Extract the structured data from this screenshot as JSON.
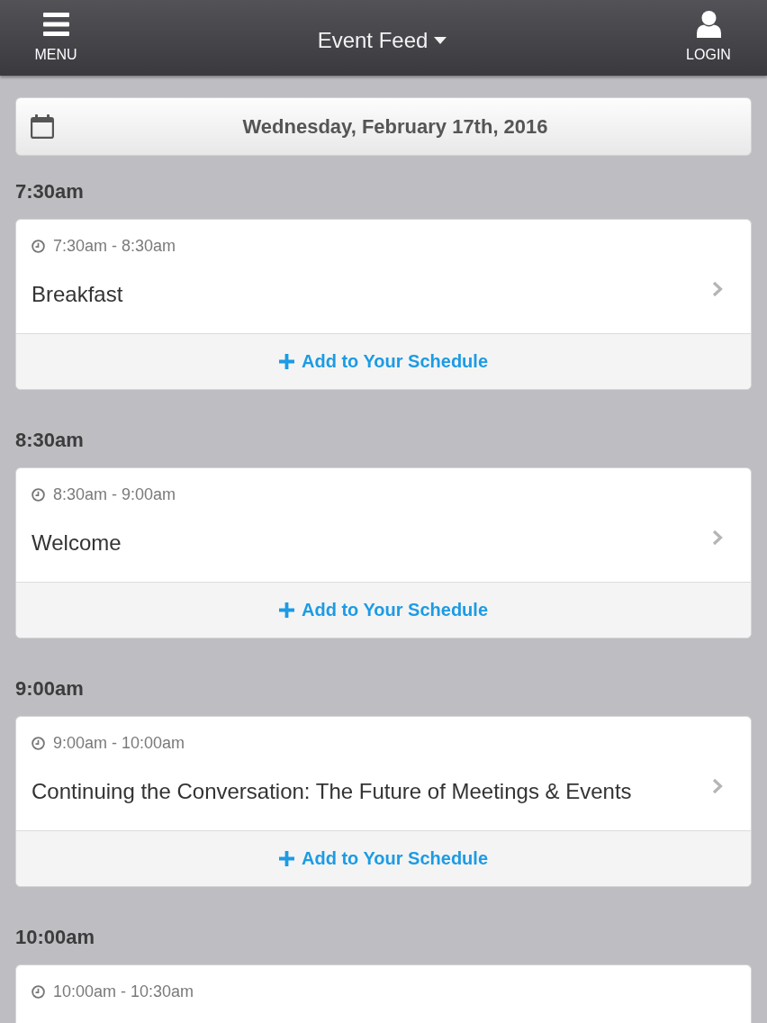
{
  "header": {
    "menu_label": "MENU",
    "title": "Event Feed",
    "login_label": "LOGIN"
  },
  "date_bar": {
    "date": "Wednesday, February 17th, 2016"
  },
  "time_slots": [
    {
      "time": "7:30am",
      "events": [
        {
          "time_range": "7:30am - 8:30am",
          "title": "Breakfast",
          "action": "Add to Your Schedule"
        }
      ]
    },
    {
      "time": "8:30am",
      "events": [
        {
          "time_range": "8:30am - 9:00am",
          "title": "Welcome",
          "action": "Add to Your Schedule"
        }
      ]
    },
    {
      "time": "9:00am",
      "events": [
        {
          "time_range": "9:00am - 10:00am",
          "title": "Continuing the Conversation: The Future of Meetings & Events",
          "action": "Add to Your Schedule"
        }
      ]
    },
    {
      "time": "10:00am",
      "events": [
        {
          "time_range": "10:00am - 10:30am"
        }
      ]
    }
  ]
}
